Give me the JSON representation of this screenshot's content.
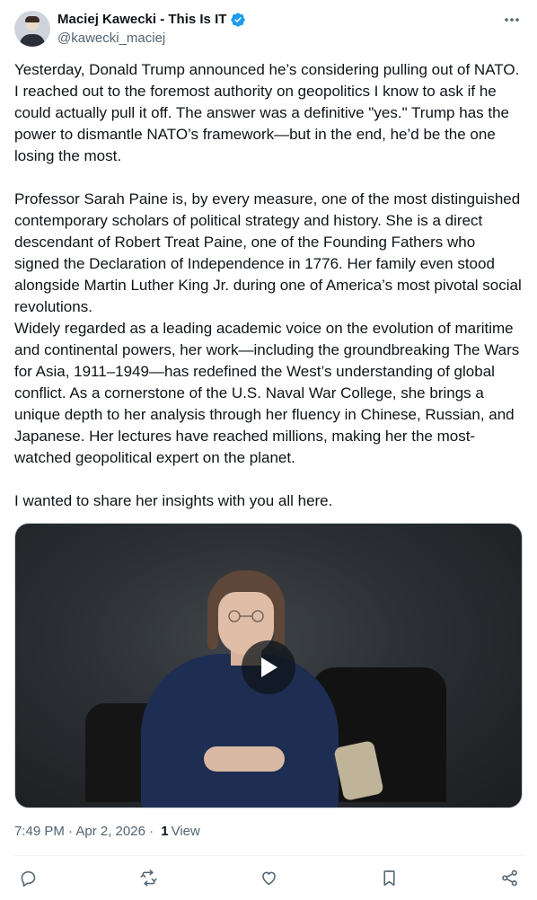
{
  "author": {
    "display_name": "Maciej Kawecki - This Is IT",
    "handle": "@kawecki_maciej",
    "verified_color": "#1d9bf0"
  },
  "tweet": {
    "text": "Yesterday, Donald Trump announced he’s considering pulling out of NATO. I reached out to the foremost authority on geopolitics I know to ask if he could actually pull it off. The answer was a definitive \"yes.\" Trump has the power to dismantle NATO’s framework—but in the end, he’d be the one losing the most.\n\nProfessor Sarah Paine is, by every measure, one of the most distinguished contemporary scholars of political strategy and history. She is a direct descendant of Robert Treat Paine, one of the Founding Fathers who signed the Declaration of Independence in 1776. Her family even stood alongside Martin Luther King Jr. during one of America’s most pivotal social revolutions.\nWidely regarded as a leading academic voice on the evolution of maritime and continental powers, her work—including the groundbreaking The Wars for Asia, 1911–1949—has redefined the West’s understanding of global conflict. As a cornerstone of the U.S. Naval War College, she brings a unique depth to her analysis through her fluency in Chinese, Russian, and Japanese. Her lectures have reached millions, making her the most-watched geopolitical expert on the planet.\n\nI wanted to share her insights with you all here."
  },
  "meta": {
    "timestamp": "7:49 PM · Apr 2, 2026 · ",
    "views_count": "1",
    "views_label": "View"
  },
  "icons": {
    "more": "more-icon",
    "play": "play-icon",
    "reply": "reply-icon",
    "repost": "repost-icon",
    "like": "like-icon",
    "bookmark": "bookmark-icon",
    "share": "share-icon"
  }
}
